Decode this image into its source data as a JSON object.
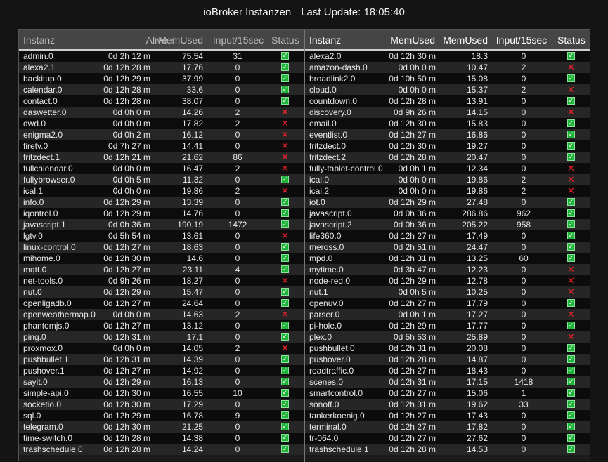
{
  "header": {
    "title": "ioBroker Instanzen",
    "last_update_label": "Last Update:",
    "last_update_time": "18:05:40"
  },
  "columns": {
    "name": "Instanz",
    "alive": "Alive",
    "mem": "MemUsed",
    "input": "Input/15sec",
    "status": "Status"
  },
  "status_colors": {
    "ok": "#21b43a",
    "error": "#e8232a"
  },
  "left": [
    {
      "name": "admin.0",
      "alive": "0d 2h 12 m",
      "mem": "75.54",
      "input": "31",
      "ok": true
    },
    {
      "name": "alexa2.1",
      "alive": "0d 12h 28 m",
      "mem": "17.76",
      "input": "0",
      "ok": true
    },
    {
      "name": "backitup.0",
      "alive": "0d 12h 29 m",
      "mem": "37.99",
      "input": "0",
      "ok": true
    },
    {
      "name": "calendar.0",
      "alive": "0d 12h 28 m",
      "mem": "33.6",
      "input": "0",
      "ok": true
    },
    {
      "name": "contact.0",
      "alive": "0d 12h 28 m",
      "mem": "38.07",
      "input": "0",
      "ok": true
    },
    {
      "name": "daswetter.0",
      "alive": "0d 0h 0 m",
      "mem": "14.26",
      "input": "2",
      "ok": false
    },
    {
      "name": "dwd.0",
      "alive": "0d 0h 0 m",
      "mem": "17.82",
      "input": "2",
      "ok": false
    },
    {
      "name": "enigma2.0",
      "alive": "0d 0h 2 m",
      "mem": "16.12",
      "input": "0",
      "ok": false
    },
    {
      "name": "firetv.0",
      "alive": "0d 7h 27 m",
      "mem": "14.41",
      "input": "0",
      "ok": false
    },
    {
      "name": "fritzdect.1",
      "alive": "0d 12h 21 m",
      "mem": "21.62",
      "input": "86",
      "ok": false
    },
    {
      "name": "fullcalendar.0",
      "alive": "0d 0h 0 m",
      "mem": "16.47",
      "input": "2",
      "ok": false
    },
    {
      "name": "fullybrowser.0",
      "alive": "0d 0h 5 m",
      "mem": "11.32",
      "input": "0",
      "ok": true
    },
    {
      "name": "ical.1",
      "alive": "0d 0h 0 m",
      "mem": "19.86",
      "input": "2",
      "ok": false
    },
    {
      "name": "info.0",
      "alive": "0d 12h 29 m",
      "mem": "13.39",
      "input": "0",
      "ok": true
    },
    {
      "name": "iqontrol.0",
      "alive": "0d 12h 29 m",
      "mem": "14.76",
      "input": "0",
      "ok": true
    },
    {
      "name": "javascript.1",
      "alive": "0d 0h 36 m",
      "mem": "190.19",
      "input": "1472",
      "ok": true
    },
    {
      "name": "lgtv.0",
      "alive": "0d 5h 54 m",
      "mem": "13.61",
      "input": "0",
      "ok": false
    },
    {
      "name": "linux-control.0",
      "alive": "0d 12h 27 m",
      "mem": "18.63",
      "input": "0",
      "ok": true
    },
    {
      "name": "mihome.0",
      "alive": "0d 12h 30 m",
      "mem": "14.6",
      "input": "0",
      "ok": true
    },
    {
      "name": "mqtt.0",
      "alive": "0d 12h 27 m",
      "mem": "23.11",
      "input": "4",
      "ok": true
    },
    {
      "name": "net-tools.0",
      "alive": "0d 9h 26 m",
      "mem": "18.27",
      "input": "0",
      "ok": false
    },
    {
      "name": "nut.0",
      "alive": "0d 12h 29 m",
      "mem": "15.47",
      "input": "0",
      "ok": true
    },
    {
      "name": "openligadb.0",
      "alive": "0d 12h 27 m",
      "mem": "24.64",
      "input": "0",
      "ok": true
    },
    {
      "name": "openweathermap.0",
      "alive": "0d 0h 0 m",
      "mem": "14.63",
      "input": "2",
      "ok": false
    },
    {
      "name": "phantomjs.0",
      "alive": "0d 12h 27 m",
      "mem": "13.12",
      "input": "0",
      "ok": true
    },
    {
      "name": "ping.0",
      "alive": "0d 12h 31 m",
      "mem": "17.1",
      "input": "0",
      "ok": true
    },
    {
      "name": "proxmox.0",
      "alive": "0d 0h 0 m",
      "mem": "14.05",
      "input": "2",
      "ok": false
    },
    {
      "name": "pushbullet.1",
      "alive": "0d 12h 31 m",
      "mem": "14.39",
      "input": "0",
      "ok": true
    },
    {
      "name": "pushover.1",
      "alive": "0d 12h 27 m",
      "mem": "14.92",
      "input": "0",
      "ok": true
    },
    {
      "name": "sayit.0",
      "alive": "0d 12h 29 m",
      "mem": "16.13",
      "input": "0",
      "ok": true
    },
    {
      "name": "simple-api.0",
      "alive": "0d 12h 30 m",
      "mem": "16.55",
      "input": "10",
      "ok": true
    },
    {
      "name": "socketio.0",
      "alive": "0d 12h 30 m",
      "mem": "17.29",
      "input": "0",
      "ok": true
    },
    {
      "name": "sql.0",
      "alive": "0d 12h 29 m",
      "mem": "16.78",
      "input": "9",
      "ok": true
    },
    {
      "name": "telegram.0",
      "alive": "0d 12h 30 m",
      "mem": "21.25",
      "input": "0",
      "ok": true
    },
    {
      "name": "time-switch.0",
      "alive": "0d 12h 28 m",
      "mem": "14.38",
      "input": "0",
      "ok": true
    },
    {
      "name": "trashschedule.0",
      "alive": "0d 12h 28 m",
      "mem": "14.24",
      "input": "0",
      "ok": true
    }
  ],
  "right": [
    {
      "name": "alexa2.0",
      "alive": "0d 12h 30 m",
      "mem": "18.3",
      "input": "0",
      "ok": true
    },
    {
      "name": "amazon-dash.0",
      "alive": "0d 0h 0 m",
      "mem": "10.47",
      "input": "2",
      "ok": false
    },
    {
      "name": "broadlink2.0",
      "alive": "0d 10h 50 m",
      "mem": "15.08",
      "input": "0",
      "ok": true
    },
    {
      "name": "cloud.0",
      "alive": "0d 0h 0 m",
      "mem": "15.37",
      "input": "2",
      "ok": false
    },
    {
      "name": "countdown.0",
      "alive": "0d 12h 28 m",
      "mem": "13.91",
      "input": "0",
      "ok": true
    },
    {
      "name": "discovery.0",
      "alive": "0d 9h 26 m",
      "mem": "14.15",
      "input": "0",
      "ok": false
    },
    {
      "name": "email.0",
      "alive": "0d 12h 30 m",
      "mem": "15.83",
      "input": "0",
      "ok": true
    },
    {
      "name": "eventlist.0",
      "alive": "0d 12h 27 m",
      "mem": "16.86",
      "input": "0",
      "ok": true
    },
    {
      "name": "fritzdect.0",
      "alive": "0d 12h 30 m",
      "mem": "19.27",
      "input": "0",
      "ok": true
    },
    {
      "name": "fritzdect.2",
      "alive": "0d 12h 28 m",
      "mem": "20.47",
      "input": "0",
      "ok": true
    },
    {
      "name": "fully-tablet-control.0",
      "alive": "0d 0h 1 m",
      "mem": "12.34",
      "input": "0",
      "ok": false
    },
    {
      "name": "ical.0",
      "alive": "0d 0h 0 m",
      "mem": "19.86",
      "input": "2",
      "ok": false
    },
    {
      "name": "ical.2",
      "alive": "0d 0h 0 m",
      "mem": "19.86",
      "input": "2",
      "ok": false
    },
    {
      "name": "iot.0",
      "alive": "0d 12h 29 m",
      "mem": "27.48",
      "input": "0",
      "ok": true
    },
    {
      "name": "javascript.0",
      "alive": "0d 0h 36 m",
      "mem": "286.86",
      "input": "962",
      "ok": true
    },
    {
      "name": "javascript.2",
      "alive": "0d 0h 36 m",
      "mem": "205.22",
      "input": "958",
      "ok": true
    },
    {
      "name": "life360.0",
      "alive": "0d 12h 27 m",
      "mem": "17.49",
      "input": "0",
      "ok": true
    },
    {
      "name": "meross.0",
      "alive": "0d 2h 51 m",
      "mem": "24.47",
      "input": "0",
      "ok": true
    },
    {
      "name": "mpd.0",
      "alive": "0d 12h 31 m",
      "mem": "13.25",
      "input": "60",
      "ok": true
    },
    {
      "name": "mytime.0",
      "alive": "0d 3h 47 m",
      "mem": "12.23",
      "input": "0",
      "ok": false
    },
    {
      "name": "node-red.0",
      "alive": "0d 12h 29 m",
      "mem": "12.78",
      "input": "0",
      "ok": false
    },
    {
      "name": "nut.1",
      "alive": "0d 0h 5 m",
      "mem": "10.25",
      "input": "0",
      "ok": false
    },
    {
      "name": "openuv.0",
      "alive": "0d 12h 27 m",
      "mem": "17.79",
      "input": "0",
      "ok": true
    },
    {
      "name": "parser.0",
      "alive": "0d 0h 1 m",
      "mem": "17.27",
      "input": "0",
      "ok": false
    },
    {
      "name": "pi-hole.0",
      "alive": "0d 12h 29 m",
      "mem": "17.77",
      "input": "0",
      "ok": true
    },
    {
      "name": "plex.0",
      "alive": "0d 5h 53 m",
      "mem": "25.89",
      "input": "0",
      "ok": false
    },
    {
      "name": "pushbullet.0",
      "alive": "0d 12h 31 m",
      "mem": "20.08",
      "input": "0",
      "ok": true
    },
    {
      "name": "pushover.0",
      "alive": "0d 12h 28 m",
      "mem": "14.87",
      "input": "0",
      "ok": true
    },
    {
      "name": "roadtraffic.0",
      "alive": "0d 12h 27 m",
      "mem": "18.43",
      "input": "0",
      "ok": true
    },
    {
      "name": "scenes.0",
      "alive": "0d 12h 31 m",
      "mem": "17.15",
      "input": "1418",
      "ok": true
    },
    {
      "name": "smartcontrol.0",
      "alive": "0d 12h 27 m",
      "mem": "15.06",
      "input": "1",
      "ok": true
    },
    {
      "name": "sonoff.0",
      "alive": "0d 12h 31 m",
      "mem": "19.62",
      "input": "33",
      "ok": true
    },
    {
      "name": "tankerkoenig.0",
      "alive": "0d 12h 27 m",
      "mem": "17.43",
      "input": "0",
      "ok": true
    },
    {
      "name": "terminal.0",
      "alive": "0d 12h 27 m",
      "mem": "17.82",
      "input": "0",
      "ok": true
    },
    {
      "name": "tr-064.0",
      "alive": "0d 12h 27 m",
      "mem": "27.62",
      "input": "0",
      "ok": true
    },
    {
      "name": "trashschedule.1",
      "alive": "0d 12h 28 m",
      "mem": "14.53",
      "input": "0",
      "ok": true
    }
  ]
}
